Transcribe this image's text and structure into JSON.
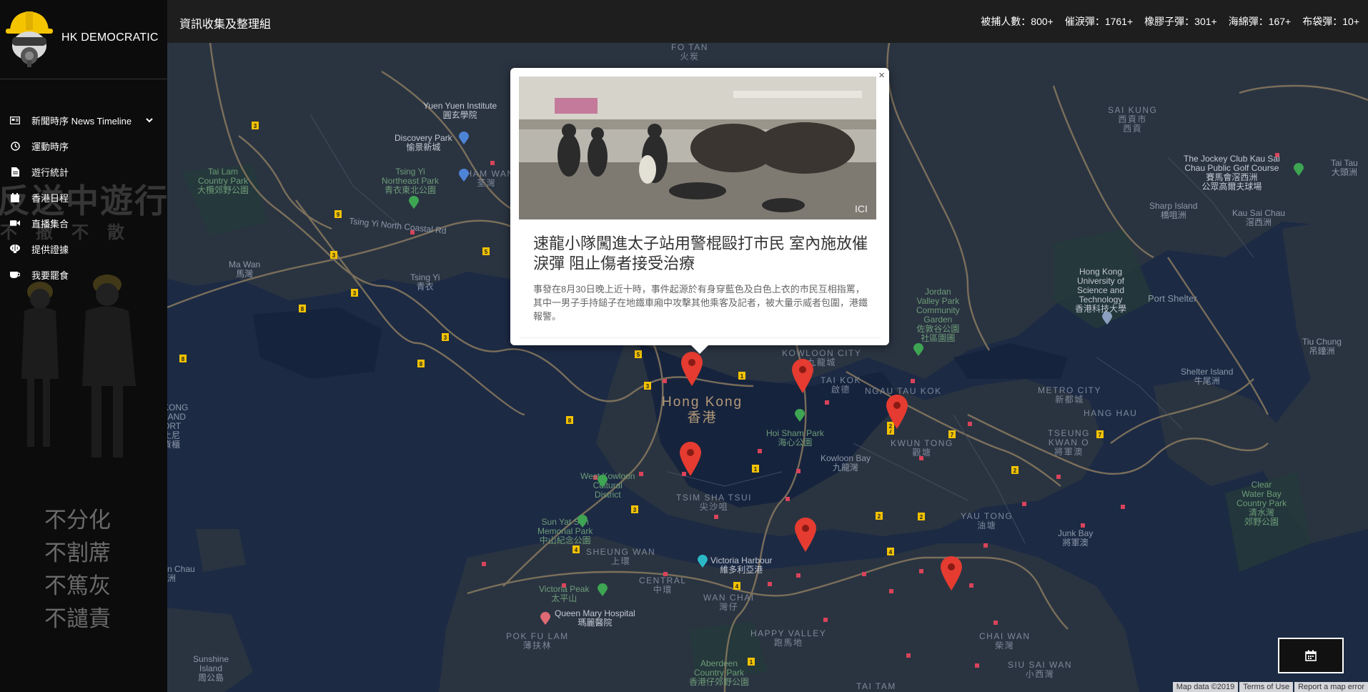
{
  "brand": {
    "name": "HK DEMOCRATIC"
  },
  "sidebar": {
    "items": [
      {
        "label": "新聞時序 News Timeline",
        "icon": "newspaper-icon"
      },
      {
        "label": "運動時序",
        "icon": "clock-icon"
      },
      {
        "label": "遊行統計",
        "icon": "document-icon"
      },
      {
        "label": "香港日程",
        "icon": "calendar-icon"
      },
      {
        "label": "直播集合",
        "icon": "video-icon"
      },
      {
        "label": "提供證據",
        "icon": "brain-icon"
      },
      {
        "label": "我要罷食",
        "icon": "cup-icon"
      }
    ],
    "background_text": "反送中遊行",
    "background_subtext": "不撤不散",
    "motto": [
      "不分化",
      "不割蓆",
      "不篤灰",
      "不譴責"
    ]
  },
  "topbar": {
    "title": "資訊收集及整理組",
    "stats": [
      "被捕人數：800+",
      "催淚彈：1761+",
      "橡膠子彈：301+",
      "海綿彈：167+",
      "布袋彈：10+"
    ]
  },
  "popup": {
    "close": "×",
    "title": "速龍小隊闖進太子站用警棍毆打市民 室內施放催淚彈 阻止傷者接受治療",
    "body": "事發在8月30日晚上近十時，事件起源於有身穿藍色及白色上衣的市民互相指罵，其中一男子手持鎚子在地鐵車廂中攻擊其他乘客及記者，被大量示威者包圍，港鐵報警。"
  },
  "map": {
    "labels": {
      "fotan": "FO TAN\n火炭",
      "yuen_yuen": "Yuen Yuen Institute\n圓玄學院",
      "discovery": "Discovery Park\n愉景新城",
      "tai_lam": "Tai Lam\nCountry Park\n大欖郊野公園",
      "tsing_yi_np": "Tsing Yi\nNortheast Park\n青衣東北公園",
      "tsing_yi_rd": "Tsing Yi North Coastal Rd",
      "ma_wan": "Ma Wan\n馬灣",
      "tsing_yi": "Tsing Yi\n青衣",
      "sai_kung": "SAI KUNG\n西貢市\n西貢",
      "jockey": "The Jockey Club Kau Sai\nChau Public Golf Course\n賽馬會滘西洲\n公眾高爾夫球場",
      "tai_tau": "Tai Tau\n大頭洲",
      "sharp_island": "Sharp Island\n橋咀洲",
      "kau_sai_chau": "Kau Sai Chau\n滘西洲",
      "hkust": "Hong Kong\nUniversity of\nScience and\nTechnology\n香港科技大學",
      "port_shelter": "Port Shelter",
      "jordan_valley": "Jordan\nValley Park\nCommunity\nGarden\n佐敦谷公園\n社區園圃",
      "kowloon_city": "KOWLOON CITY\n九龍城",
      "tai_kok": "TAI KOK\n啟德",
      "ngau_tau_kok": "NGAU TAU KOK",
      "metro_city": "METRO CITY\n新都城",
      "tiu_chung": "Tiu Chung\n吊鐘洲",
      "shelter_island": "Shelter Island\n牛尾洲",
      "hang_hau": "HANG HAU",
      "tseung_kwan_o": "TSEUNG\nKWAN O\n將軍澳",
      "hong_kong": "Hong Kong\n香港",
      "hoi_sham": "Hoi Sham Park\n海心公園",
      "kwun_tong": "KWUN TONG\n觀塘",
      "kowloon_bay": "Kowloon Bay\n九龍灣",
      "west_kowloon": "West Kowloon\nCultural\nDistrict",
      "tsim_sha_tsui": "TSIM SHA TSUI\n尖沙咀",
      "sun_yat_sen": "Sun Yat Sen\nMemorial Park\n中山紀念公園",
      "sheung_wan": "SHEUNG WAN\n上環",
      "victoria_harbour": "Victoria Harbour\n維多利亞港",
      "central": "CENTRAL\n中環",
      "wan_chai": "WAN CHAI\n灣仔",
      "victoria_peak": "Victoria Peak\n太平山",
      "queen_mary": "Queen Mary Hospital\n瑪麗醫院",
      "pok_fu_lam": "POK FU LAM\n薄扶林",
      "happy_valley": "HAPPY VALLEY\n跑馬地",
      "aberdeen": "Aberdeen\nCountry Park\n香港仔郊野公園",
      "chai_wan": "CHAI WAN\n柴灣",
      "siu_sai_wan": "SIU SAI WAN\n小西灣",
      "tai_tam": "TAI TAM",
      "sunshine": "Sunshine\nIsland\n周公島",
      "yau_tong": "YAU TONG\n油塘",
      "junk_bay": "Junk Bay\n將軍澳",
      "clear_water": "Clear\nWater Bay\nCountry Park\n清水灣\n郊野公園",
      "sai_kung_west": "SAI KUNG\n西貢",
      "kowloon_port": "KONG\nLAND\nORT\n土尼\n貨櫃",
      "ha_chau": "n Chau\n洲",
      "kam_wan": "SHAM WAN\n荃灣"
    },
    "attribution": [
      "Map data ©2019",
      "Terms of Use",
      "Report a map error"
    ]
  },
  "colors": {
    "map_bg": "#1c2a44",
    "land": "#2a3441",
    "water": "#16233d",
    "road": "#8a7a5f",
    "pin": "#e53b30",
    "sidebar_bg": "#0c0c0c",
    "topbar_bg": "#1e1e1e"
  }
}
